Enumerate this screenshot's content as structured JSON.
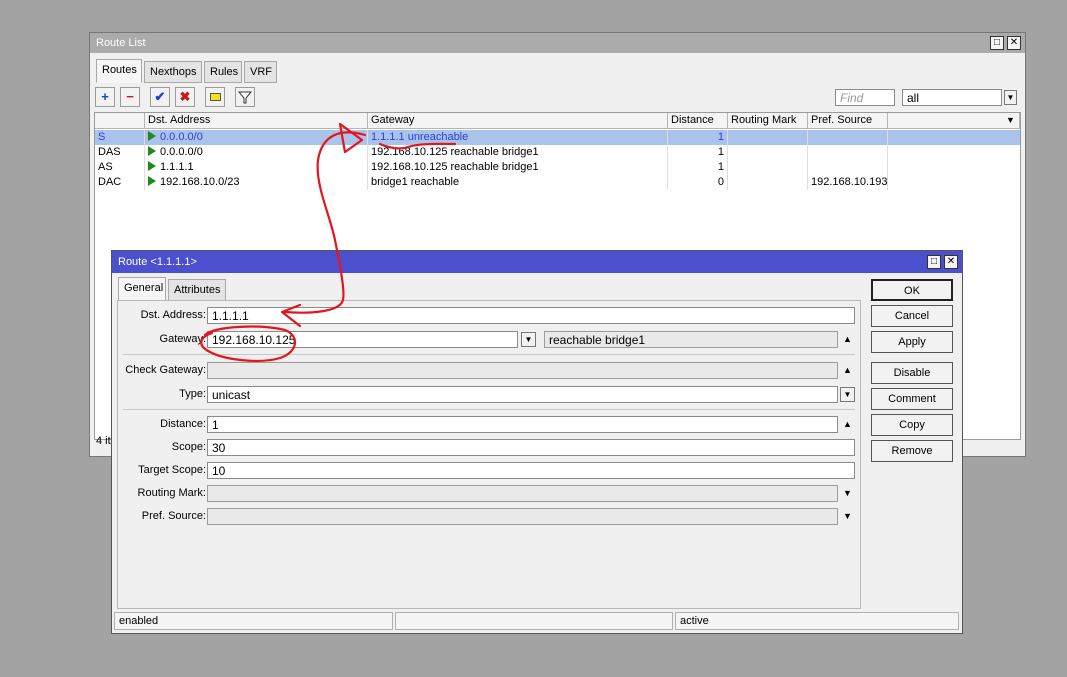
{
  "route_list": {
    "title": "Route List",
    "tabs": [
      "Routes",
      "Nexthops",
      "Rules",
      "VRF"
    ],
    "toolbar": {
      "add": "+",
      "remove": "−",
      "enable": "✔",
      "disable": "✖",
      "comment": "",
      "filter": "",
      "find_placeholder": "Find",
      "filter_value": "all"
    },
    "columns": [
      "",
      "Dst. Address",
      "Gateway",
      "Distance",
      "Routing Mark",
      "Pref. Source"
    ],
    "rows": [
      {
        "flags": "S",
        "dst": "0.0.0.0/0",
        "gateway": "1.1.1.1 unreachable",
        "distance": "1",
        "mark": "",
        "pref": ""
      },
      {
        "flags": "DAS",
        "dst": "0.0.0.0/0",
        "gateway": "192.168.10.125 reachable bridge1",
        "distance": "1",
        "mark": "",
        "pref": ""
      },
      {
        "flags": "AS",
        "dst": "1.1.1.1",
        "gateway": "192.168.10.125 reachable bridge1",
        "distance": "1",
        "mark": "",
        "pref": ""
      },
      {
        "flags": "DAC",
        "dst": "192.168.10.0/23",
        "gateway": "bridge1 reachable",
        "distance": "0",
        "mark": "",
        "pref": "192.168.10.193"
      }
    ],
    "status_count": "4 it"
  },
  "dialog": {
    "title": "Route <1.1.1.1>",
    "tabs": [
      "General",
      "Attributes"
    ],
    "labels": {
      "dst": "Dst. Address:",
      "gateway": "Gateway:",
      "check_gateway": "Check Gateway:",
      "type": "Type:",
      "distance": "Distance:",
      "scope": "Scope:",
      "target_scope": "Target Scope:",
      "routing_mark": "Routing Mark:",
      "pref_source": "Pref. Source:"
    },
    "values": {
      "dst": "1.1.1.1",
      "gateway": "192.168.10.125",
      "gateway_state": "reachable bridge1",
      "check_gateway": "",
      "type": "unicast",
      "distance": "1",
      "scope": "30",
      "target_scope": "10",
      "routing_mark": "",
      "pref_source": ""
    },
    "buttons": [
      "OK",
      "Cancel",
      "Apply",
      "Disable",
      "Comment",
      "Copy",
      "Remove"
    ],
    "status": [
      "enabled",
      "",
      "active"
    ]
  },
  "colors": {
    "selection": "#a9c3eb",
    "dialog_title": "#4b50cf",
    "annotation": "#e3151d",
    "link_text": "#2a3fd8"
  }
}
